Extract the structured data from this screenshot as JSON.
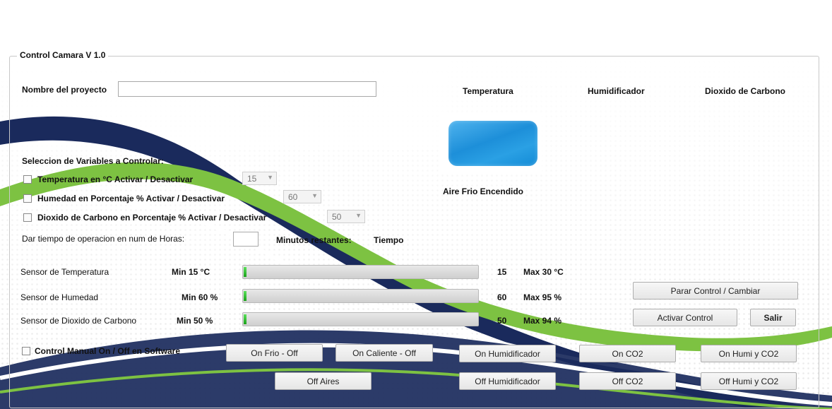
{
  "window": {
    "group_title": "Control Camara V 1.0"
  },
  "project": {
    "name_label": "Nombre del proyecto",
    "name_value": ""
  },
  "headers": {
    "temperature": "Temperatura",
    "humidifier": "Humidificador",
    "co2": "Dioxido de Carbono"
  },
  "status": {
    "ac_status": "Aire Frio Encendido",
    "ac_icon": "air-conditioner-image"
  },
  "variables": {
    "title": "Seleccion de Variables a Controlar:",
    "items": [
      {
        "label": "Temperatura en °C  Activar / Desactivar",
        "checked": false,
        "value": "15"
      },
      {
        "label": "Humedad  en Porcentaje %  Activar / Desactivar",
        "checked": false,
        "value": "60"
      },
      {
        "label": "Dioxido de Carbono en Porcentaje %  Activar / Desactivar",
        "checked": false,
        "value": "50"
      }
    ]
  },
  "time": {
    "label": "Dar tiempo de operacion en num de Horas:",
    "hours_value": "",
    "remaining_label": "Minutos restantes:",
    "remaining_value": "Tiempo"
  },
  "sensors": [
    {
      "name": "Sensor de Temperatura",
      "min": "Min 15 °C",
      "value": "15",
      "max": "Max 30 °C",
      "progress": 0
    },
    {
      "name": "Sensor de Humedad",
      "min": "Min 60 %",
      "value": "60",
      "max": "Max 95 %",
      "progress": 0
    },
    {
      "name": "Sensor de Dioxido de Carbono",
      "min": "Min 50 %",
      "value": "50",
      "max": "Max 94 %",
      "progress": 0
    }
  ],
  "controls": {
    "stop_change": "Parar Control / Cambiar",
    "activate": "Activar Control",
    "exit": "Salir"
  },
  "manual": {
    "label": "Control Manual On / Off en Software",
    "checked": false,
    "buttons": {
      "on_frio_off": "On Frio - Off",
      "on_caliente_off": "On Caliente - Off",
      "on_humidificador": "On Humidificador",
      "on_co2": "On CO2",
      "on_humi_co2": "On Humi y CO2",
      "off_aires": "Off Aires",
      "off_humidificador": "Off Humidificador",
      "off_co2": "Off CO2",
      "off_humi_co2": "Off Humi y CO2"
    }
  },
  "colors": {
    "accent_green": "#7dc242",
    "wave_navy": "#1a2a5c",
    "ac_blue": "#1d8fd9"
  }
}
